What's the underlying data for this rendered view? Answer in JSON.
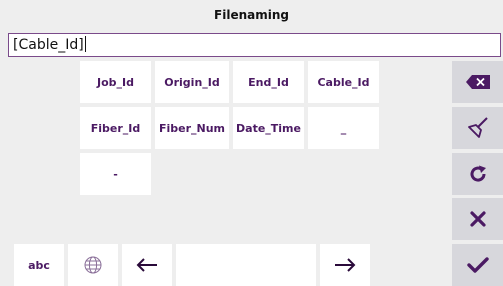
{
  "window": {
    "title": "Filenaming"
  },
  "input": {
    "value": "[Cable_Id]"
  },
  "keys": {
    "job_id": "Job_Id",
    "origin_id": "Origin_Id",
    "end_id": "End_Id",
    "cable_id": "Cable_Id",
    "fiber_id": "Fiber_Id",
    "fiber_num": "Fiber_Num",
    "date_time": "Date_Time",
    "underscore": "_",
    "dash": "-"
  },
  "bottom": {
    "abc": "abc"
  },
  "icons": {
    "backspace": "backspace-icon",
    "clear": "broom-clear-icon",
    "reset": "refresh-icon",
    "cancel": "close-icon",
    "confirm": "check-icon",
    "language": "globe-icon",
    "left": "arrow-left-icon",
    "right": "arrow-right-icon"
  },
  "colors": {
    "accent": "#4b1a63",
    "background": "#eeeeee",
    "side_button": "#d7d7dc"
  }
}
